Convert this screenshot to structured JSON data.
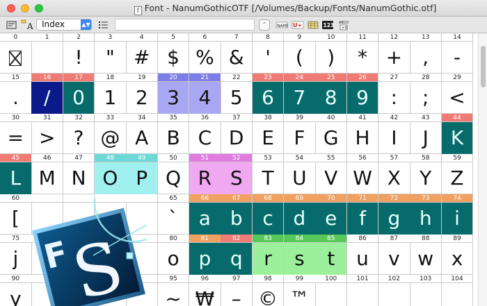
{
  "window": {
    "title": "Font - NanumGothicOTF [/Volumes/Backup/Fonts/NanumGothic.otf]",
    "title_icon": "font-document-icon"
  },
  "toolbar": {
    "view_mode": "Index",
    "search_value": "",
    "buttons": [
      "metrics-icon",
      "glyph-editor-icon",
      "list-icon",
      "stepper-icon",
      "name-icon",
      "unicode-icon",
      "grid-icon",
      "index-view-icon",
      "hex-view-icon"
    ]
  },
  "logo": {
    "letters": "FS",
    "name": "fontforge-style-logo"
  },
  "colors": {
    "teal": "#086b6b",
    "navy": "#0a1a8a",
    "red_label": "#f07b74",
    "orange_label": "#f0a060",
    "blue": "#a8a8f2",
    "pink": "#f0a8f0",
    "cyan": "#a0f0f0",
    "green": "#9cf09c"
  },
  "grid": {
    "columns": 15,
    "rows": [
      [
        {
          "i": "0",
          "g": "",
          "s": "notdef"
        },
        {
          "i": "1",
          "g": ""
        },
        {
          "i": "2",
          "g": "!"
        },
        {
          "i": "3",
          "g": "\""
        },
        {
          "i": "4",
          "g": "#"
        },
        {
          "i": "5",
          "g": "$"
        },
        {
          "i": "6",
          "g": "%"
        },
        {
          "i": "7",
          "g": "&"
        },
        {
          "i": "8",
          "g": "'"
        },
        {
          "i": "9",
          "g": "("
        },
        {
          "i": "10",
          "g": ")"
        },
        {
          "i": "11",
          "g": "*"
        },
        {
          "i": "12",
          "g": "+"
        },
        {
          "i": "13",
          "g": ","
        },
        {
          "i": "14",
          "g": "-"
        }
      ],
      [
        {
          "i": "15",
          "g": "."
        },
        {
          "i": "16",
          "g": "/",
          "s": "sel-navy"
        },
        {
          "i": "17",
          "g": "0",
          "s": "sel"
        },
        {
          "i": "18",
          "g": "1"
        },
        {
          "i": "19",
          "g": "2"
        },
        {
          "i": "20",
          "g": "3",
          "s": "sel-blue"
        },
        {
          "i": "21",
          "g": "4",
          "s": "sel-blue"
        },
        {
          "i": "22",
          "g": "5"
        },
        {
          "i": "23",
          "g": "6",
          "s": "sel"
        },
        {
          "i": "24",
          "g": "7",
          "s": "sel"
        },
        {
          "i": "25",
          "g": "8",
          "s": "sel"
        },
        {
          "i": "26",
          "g": "9",
          "s": "sel"
        },
        {
          "i": "27",
          "g": ":"
        },
        {
          "i": "28",
          "g": ";"
        },
        {
          "i": "29",
          "g": "<"
        }
      ],
      [
        {
          "i": "30",
          "g": "="
        },
        {
          "i": "31",
          "g": ">"
        },
        {
          "i": "32",
          "g": "?"
        },
        {
          "i": "33",
          "g": "@"
        },
        {
          "i": "34",
          "g": "A"
        },
        {
          "i": "35",
          "g": "B"
        },
        {
          "i": "36",
          "g": "C"
        },
        {
          "i": "37",
          "g": "D"
        },
        {
          "i": "38",
          "g": "E"
        },
        {
          "i": "39",
          "g": "F"
        },
        {
          "i": "40",
          "g": "G"
        },
        {
          "i": "41",
          "g": "H"
        },
        {
          "i": "42",
          "g": "I"
        },
        {
          "i": "43",
          "g": "J"
        },
        {
          "i": "44",
          "g": "K",
          "s": "sel"
        }
      ],
      [
        {
          "i": "45",
          "g": "L",
          "s": "sel"
        },
        {
          "i": "46",
          "g": "M"
        },
        {
          "i": "47",
          "g": "N"
        },
        {
          "i": "48",
          "g": "O",
          "s": "sel-cyan"
        },
        {
          "i": "49",
          "g": "P",
          "s": "sel-cyan"
        },
        {
          "i": "50",
          "g": "Q"
        },
        {
          "i": "51",
          "g": "R",
          "s": "sel-pink"
        },
        {
          "i": "52",
          "g": "S",
          "s": "sel-pink"
        },
        {
          "i": "53",
          "g": "T"
        },
        {
          "i": "54",
          "g": "U"
        },
        {
          "i": "55",
          "g": "V"
        },
        {
          "i": "56",
          "g": "W"
        },
        {
          "i": "57",
          "g": "X"
        },
        {
          "i": "58",
          "g": "Y"
        },
        {
          "i": "59",
          "g": "Z"
        }
      ],
      [
        {
          "i": "60",
          "g": "["
        },
        {
          "i": "",
          "g": ""
        },
        {
          "i": "",
          "g": ""
        },
        {
          "i": "",
          "g": ""
        },
        {
          "i": "",
          "g": ""
        },
        {
          "i": "65",
          "g": "`"
        },
        {
          "i": "66",
          "g": "a",
          "s": "sel-teal-orange"
        },
        {
          "i": "67",
          "g": "b",
          "s": "sel-teal-orange"
        },
        {
          "i": "68",
          "g": "c",
          "s": "sel-teal-orange"
        },
        {
          "i": "69",
          "g": "d",
          "s": "sel-teal-orange"
        },
        {
          "i": "70",
          "g": "e",
          "s": "sel-teal-orange"
        },
        {
          "i": "71",
          "g": "f",
          "s": "sel-teal-orange"
        },
        {
          "i": "72",
          "g": "g",
          "s": "sel-teal-orange"
        },
        {
          "i": "73",
          "g": "h",
          "s": "sel-teal-orange"
        },
        {
          "i": "74",
          "g": "i",
          "s": "sel-teal-orange"
        }
      ],
      [
        {
          "i": "75",
          "g": "j"
        },
        {
          "i": "",
          "g": ""
        },
        {
          "i": "",
          "g": ""
        },
        {
          "i": "",
          "g": ""
        },
        {
          "i": "",
          "g": ""
        },
        {
          "i": "80",
          "g": "o"
        },
        {
          "i": "81",
          "g": "p",
          "s": "sel-teal-orange"
        },
        {
          "i": "82",
          "g": "q",
          "s": "sel-teal-red"
        },
        {
          "i": "83",
          "g": "r",
          "s": "sel-green"
        },
        {
          "i": "84",
          "g": "s",
          "s": "sel-green"
        },
        {
          "i": "85",
          "g": "t",
          "s": "sel-green"
        },
        {
          "i": "86",
          "g": "u"
        },
        {
          "i": "87",
          "g": "v"
        },
        {
          "i": "88",
          "g": "w"
        },
        {
          "i": "89",
          "g": "x"
        }
      ],
      [
        {
          "i": "90",
          "g": "y"
        },
        {
          "i": "",
          "g": ""
        },
        {
          "i": "",
          "g": ""
        },
        {
          "i": "",
          "g": ""
        },
        {
          "i": "",
          "g": ""
        },
        {
          "i": "95",
          "g": "~"
        },
        {
          "i": "96",
          "g": "₩"
        },
        {
          "i": "97",
          "g": "–"
        },
        {
          "i": "98",
          "g": "©"
        },
        {
          "i": "99",
          "g": "™"
        },
        {
          "i": "100",
          "g": ""
        },
        {
          "i": "101",
          "g": ""
        },
        {
          "i": "102",
          "g": ""
        },
        {
          "i": "103",
          "g": ""
        },
        {
          "i": "104",
          "g": ""
        }
      ]
    ]
  }
}
